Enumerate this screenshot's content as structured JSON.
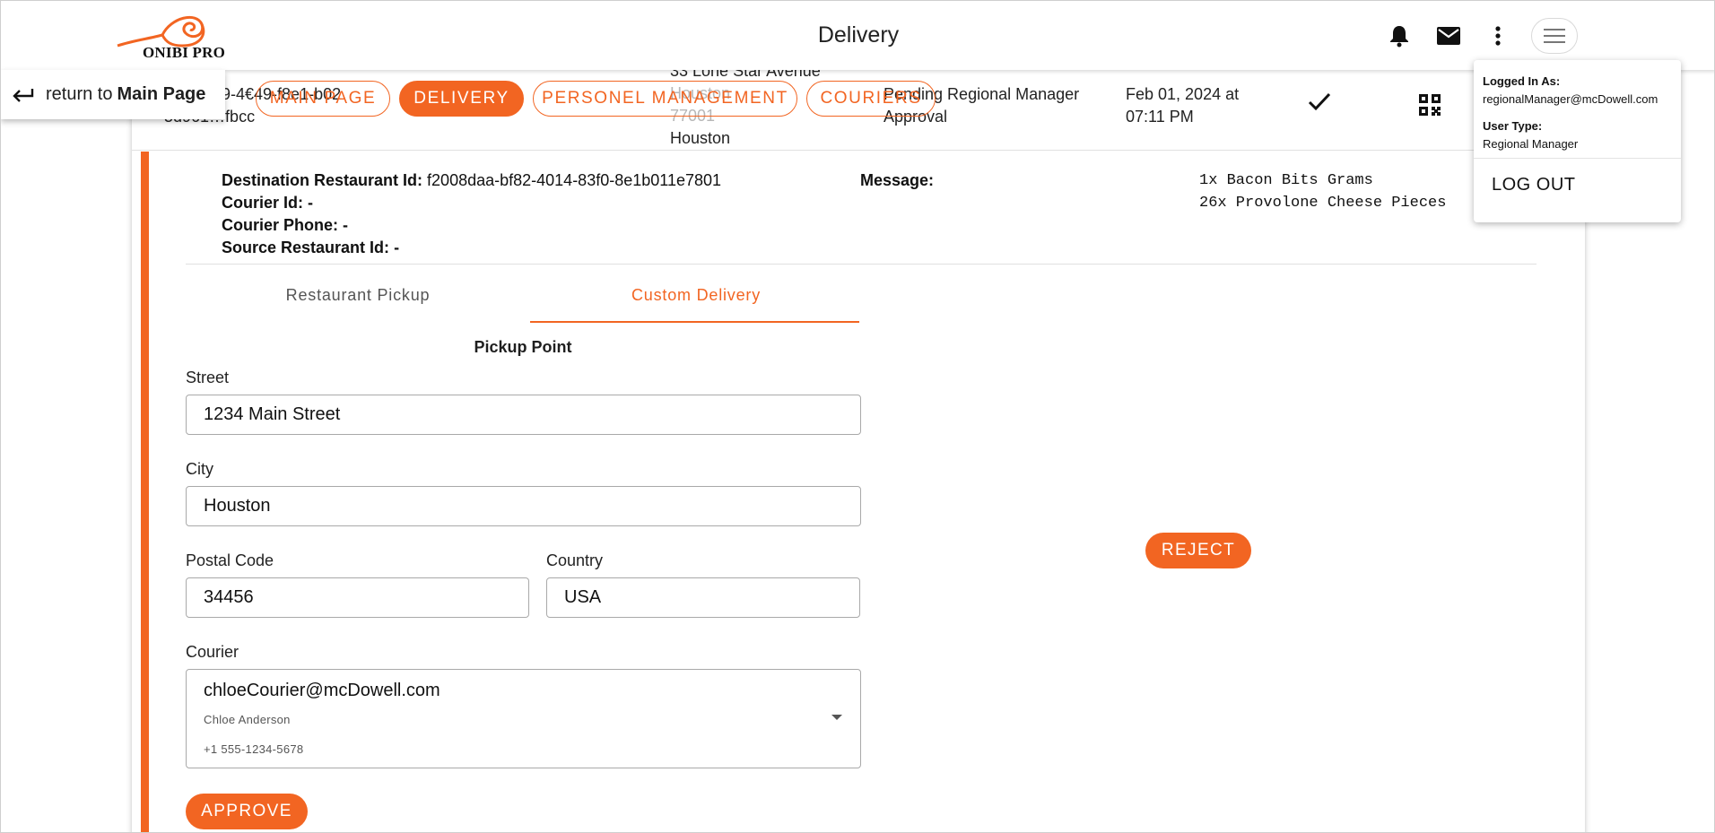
{
  "header": {
    "logo_text": "ONIBI PRO",
    "page_title": "Delivery",
    "icons": [
      "bell-icon",
      "mail-icon",
      "more-vert-icon",
      "hamburger-menu-icon"
    ]
  },
  "return_link": {
    "prefix": "return to",
    "target": "Main Page"
  },
  "nav": {
    "main_page": "MAIN PAGE",
    "delivery": "DELIVERY",
    "personel_management": "PERSONEL MANAGEMENT",
    "couriers": "COURIERS"
  },
  "row": {
    "id_line1": "9-4€49-f8e1-b02",
    "id_line2": "5d961…fbcc",
    "address_line1": "33 Lone Star Avenue",
    "address_line2": "Houston",
    "address_line3": "77001",
    "address_line4": "Houston",
    "status_line1": "Pending Regional Manager",
    "status_line2": "Approval",
    "date_line1": "Feb 01, 2024 at",
    "date_line2": "07:11 PM"
  },
  "details": {
    "destination_label": "Destination Restaurant Id:",
    "destination_value": "f2008daa-bf82-4014-83f0-8e1b011e7801",
    "courier_id_label": "Courier Id:",
    "courier_id_value": "-",
    "courier_phone_label": "Courier Phone:",
    "courier_phone_value": "-",
    "source_label": "Source Restaurant Id:",
    "source_value": "-",
    "message_label": "Message:",
    "items": [
      "1x Bacon Bits Grams",
      "26x Provolone Cheese Pieces"
    ]
  },
  "tabs": {
    "restaurant_pickup": "Restaurant Pickup",
    "custom_delivery": "Custom Delivery"
  },
  "form": {
    "section_title": "Pickup Point",
    "street_label": "Street",
    "street_value": "1234 Main Street",
    "city_label": "City",
    "city_value": "Houston",
    "postal_label": "Postal Code",
    "postal_value": "34456",
    "country_label": "Country",
    "country_value": "USA",
    "courier_label": "Courier",
    "courier_email": "chloeCourier@mcDowell.com",
    "courier_name": "Chloe Anderson",
    "courier_phone": "+1 555-1234-5678",
    "approve": "APPROVE",
    "reject": "REJECT"
  },
  "popup": {
    "logged_in_label": "Logged In As:",
    "logged_in_value": "regionalManager@mcDowell.com",
    "user_type_label": "User Type:",
    "user_type_value": "Regional Manager",
    "logout": "LOG OUT"
  },
  "colors": {
    "accent": "#f26522",
    "text": "#1f1f1f",
    "faded_text": "#b7b7b7"
  }
}
